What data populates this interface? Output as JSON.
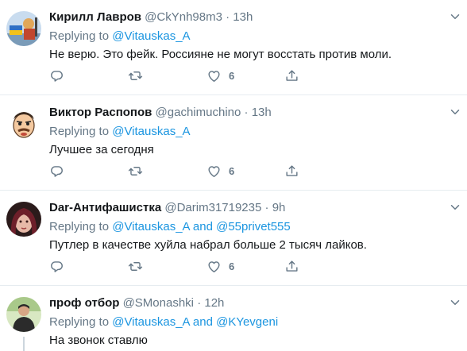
{
  "theme": {
    "name_color": "#14171a",
    "muted_color": "#657786",
    "link_color": "#1b95e0",
    "divider_color": "#e6ecf0"
  },
  "tweets": [
    {
      "name": "Кирилл Лавров",
      "handle": "@CkYnh98m3",
      "dot": "·",
      "time": "13h",
      "replying_prefix": "Replying to",
      "mention1": "@Vitauskas_A",
      "conj": "",
      "mention2": "",
      "text": "Не верю. Это фейк. Россияне не могут восстать против моли.",
      "likes": "6"
    },
    {
      "name": "Виктор Распопов",
      "handle": "@gachimuchino",
      "dot": "·",
      "time": "13h",
      "replying_prefix": "Replying to",
      "mention1": "@Vitauskas_A",
      "conj": "",
      "mention2": "",
      "text": "Лучшее за сегодня",
      "likes": "6"
    },
    {
      "name": "Dar-Антифашистка",
      "handle": "@Darim31719235",
      "dot": "·",
      "time": "9h",
      "replying_prefix": "Replying to",
      "mention1": "@Vitauskas_A",
      "conj": "and",
      "mention2": "@55privet555",
      "text": "Путлер в качестве хуйла набрал больше 2 тысяч лайков.",
      "likes": "6"
    },
    {
      "name": "проф отбор",
      "handle": "@SMonashki",
      "dot": "·",
      "time": "12h",
      "replying_prefix": "Replying to",
      "mention1": "@Vitauskas_A",
      "conj": "and",
      "mention2": "@KYevgeni",
      "text": "На звонок ставлю",
      "likes": ""
    }
  ],
  "icons": [
    "reply-icon",
    "retweet-icon",
    "like-icon",
    "share-icon",
    "chevron-down-icon"
  ]
}
